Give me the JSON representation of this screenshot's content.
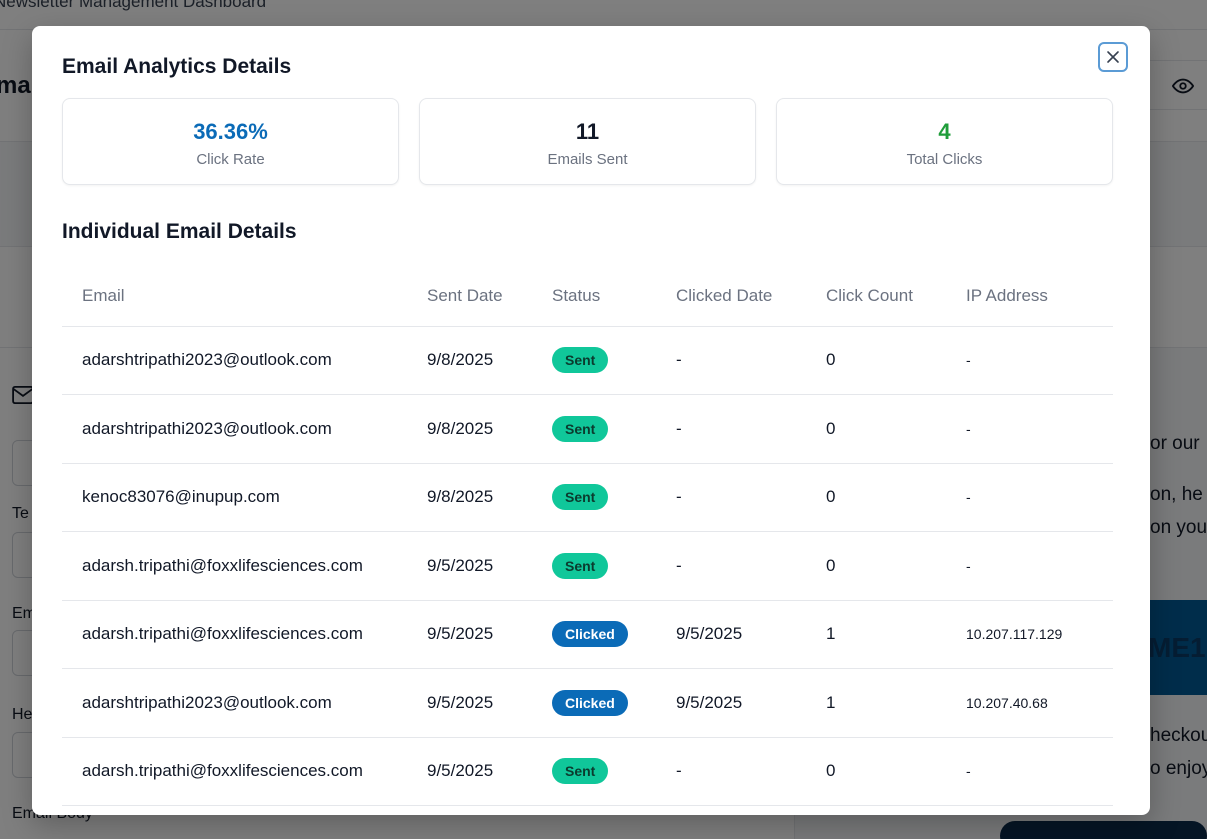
{
  "background": {
    "header_title": "Newsletter Management Dashboard",
    "bar_title": "ma",
    "label_te": "Te",
    "label_em": "Em",
    "label_he": "He",
    "label_email_body": "Email Body",
    "preview_text_1": "or our",
    "preview_text_2": "on, he",
    "preview_text_3": "on you",
    "preview_text_4": "heckou",
    "preview_text_5": "o enjoy",
    "banner_text": "ME1"
  },
  "modal": {
    "title": "Email Analytics Details",
    "close_icon": "close-icon"
  },
  "stats": [
    {
      "value": "36.36%",
      "label": "Click Rate",
      "color": "#0b6bb7"
    },
    {
      "value": "11",
      "label": "Emails Sent",
      "color": "#111827"
    },
    {
      "value": "4",
      "label": "Total Clicks",
      "color": "#1f9d3a"
    }
  ],
  "details": {
    "title": "Individual Email Details",
    "columns": [
      "Email",
      "Sent Date",
      "Status",
      "Clicked Date",
      "Click Count",
      "IP Address"
    ],
    "rows": [
      {
        "email": "adarshtripathi2023@outlook.com",
        "sent_date": "9/8/2025",
        "status": "Sent",
        "clicked_date": "-",
        "click_count": "0",
        "ip": "-"
      },
      {
        "email": "adarshtripathi2023@outlook.com",
        "sent_date": "9/8/2025",
        "status": "Sent",
        "clicked_date": "-",
        "click_count": "0",
        "ip": "-"
      },
      {
        "email": "kenoc83076@inupup.com",
        "sent_date": "9/8/2025",
        "status": "Sent",
        "clicked_date": "-",
        "click_count": "0",
        "ip": "-"
      },
      {
        "email": "adarsh.tripathi@foxxlifesciences.com",
        "sent_date": "9/5/2025",
        "status": "Sent",
        "clicked_date": "-",
        "click_count": "0",
        "ip": "-"
      },
      {
        "email": "adarsh.tripathi@foxxlifesciences.com",
        "sent_date": "9/5/2025",
        "status": "Clicked",
        "clicked_date": "9/5/2025",
        "click_count": "1",
        "ip": "10.207.117.129"
      },
      {
        "email": "adarshtripathi2023@outlook.com",
        "sent_date": "9/5/2025",
        "status": "Clicked",
        "clicked_date": "9/5/2025",
        "click_count": "1",
        "ip": "10.207.40.68"
      },
      {
        "email": "adarsh.tripathi@foxxlifesciences.com",
        "sent_date": "9/5/2025",
        "status": "Sent",
        "clicked_date": "-",
        "click_count": "0",
        "ip": "-"
      }
    ]
  }
}
